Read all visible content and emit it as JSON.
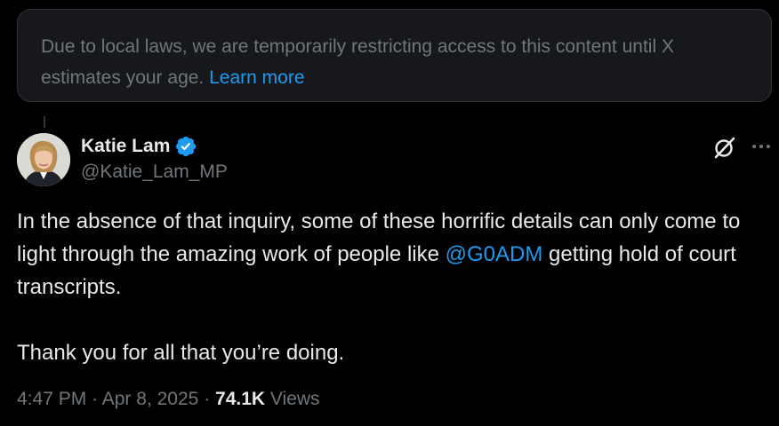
{
  "notice": {
    "text": "Due to local laws, we are temporarily restricting access to this content until X estimates your age.",
    "link": "Learn more"
  },
  "author": {
    "display_name": "Katie Lam",
    "handle": "@Katie_Lam_MP",
    "verified": true
  },
  "tweet": {
    "text_before_mention": "In the absence of that inquiry, some of these horrific details can only come to light through the amazing work of people like ",
    "mention": "@G0ADM",
    "text_after_mention": " getting hold of court transcripts.",
    "second_paragraph": "Thank you for all that you’re doing."
  },
  "meta": {
    "time": "4:47 PM",
    "separator": "·",
    "date": "Apr 8, 2025",
    "views_count": "74.1K",
    "views_label": "Views"
  },
  "icons": {
    "verified": "verified-badge-icon",
    "grok": "grok-icon",
    "more": "more-options-icon"
  },
  "colors": {
    "background": "#000000",
    "text_primary": "#e7e9ea",
    "text_secondary": "#71767b",
    "link": "#1d9bf0",
    "notice_bg": "#16181c"
  }
}
